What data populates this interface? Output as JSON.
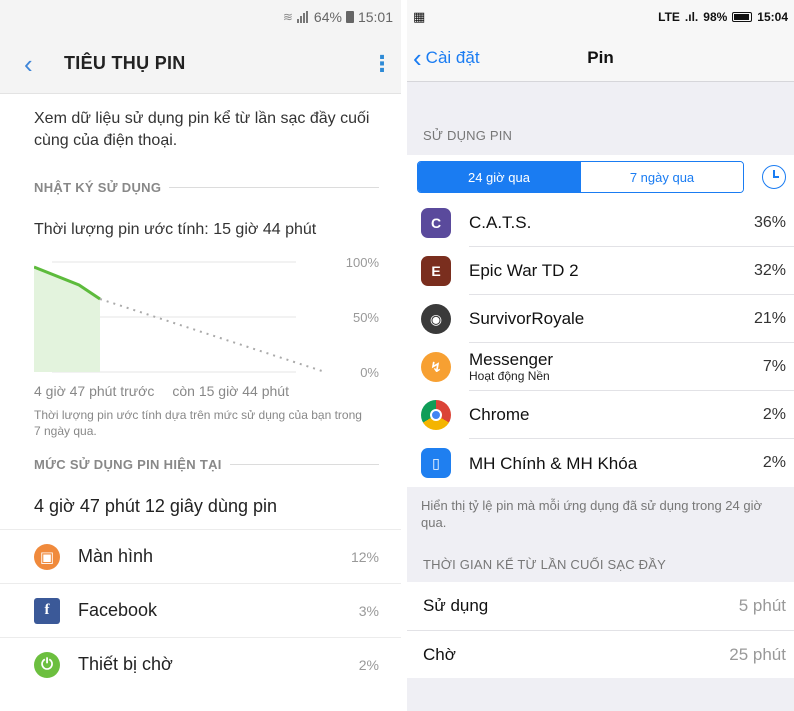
{
  "android": {
    "status": {
      "battery": "64%",
      "time": "15:01"
    },
    "title": "TIÊU THỤ PIN",
    "description": "Xem dữ liệu sử dụng pin kể từ lần sạc đầy cuối cùng của điện thoại.",
    "usage_log_header": "NHẬT KÝ SỬ DỤNG",
    "estimate": "Thời lượng pin ước tính: 15 giờ 44 phút",
    "chart_ticks": [
      "100%",
      "50%",
      "0%"
    ],
    "chart_left_label": "4 giờ 47 phút trước",
    "chart_right_label": "còn 15 giờ 44 phút",
    "chart_note": "Thời lượng pin ước tính dựa trên mức sử dụng của bạn trong 7 ngày qua.",
    "current_usage_header": "MỨC SỬ DỤNG PIN HIỆN TẠI",
    "usage_total": "4 giờ 47 phút 12 giây dùng pin",
    "apps": [
      {
        "name": "Màn hình",
        "percent": "12%",
        "icon": "screen-icon",
        "color": "#f08a3c"
      },
      {
        "name": "Facebook",
        "percent": "3%",
        "icon": "facebook-icon",
        "color": "#3b5998"
      },
      {
        "name": "Thiết bị chờ",
        "percent": "2%",
        "icon": "power-icon",
        "color": "#6cbf3f"
      }
    ]
  },
  "ios": {
    "status": {
      "network": "LTE",
      "battery": "98%",
      "time": "15:04"
    },
    "back_label": "Cài đặt",
    "title": "Pin",
    "usage_header": "SỬ DỤNG PIN",
    "segments": [
      "24 giờ qua",
      "7 ngày qua"
    ],
    "apps": [
      {
        "name": "C.A.T.S.",
        "sub": "",
        "percent": "36%",
        "icon": "cats-game-icon",
        "color": "#5a4a9c"
      },
      {
        "name": "Epic War TD 2",
        "sub": "",
        "percent": "32%",
        "icon": "epic-war-icon",
        "color": "#7a2e1e"
      },
      {
        "name": "SurvivorRoyale",
        "sub": "",
        "percent": "21%",
        "icon": "survivor-royale-icon",
        "color": "#3a3a3a"
      },
      {
        "name": "Messenger",
        "sub": "Hoạt động Nền",
        "percent": "7%",
        "icon": "messenger-icon",
        "color": "#f7a032"
      },
      {
        "name": "Chrome",
        "sub": "",
        "percent": "2%",
        "icon": "chrome-icon",
        "color": "#ffffff"
      },
      {
        "name": "MH Chính & MH Khóa",
        "sub": "",
        "percent": "2%",
        "icon": "phone-screen-icon",
        "color": "#1f7ff0"
      }
    ],
    "footer_note": "Hiển thị tỷ lệ pin mà mỗi ứng dụng đã sử dụng trong 24 giờ qua.",
    "since_charge_header": "THỜI GIAN KỂ TỪ LẦN CUỐI SẠC ĐẦY",
    "since_rows": [
      {
        "label": "Sử dụng",
        "value": "5 phút"
      },
      {
        "label": "Chờ",
        "value": "25 phút"
      }
    ]
  }
}
